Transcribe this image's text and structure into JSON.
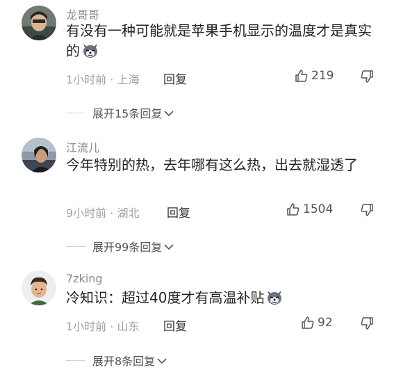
{
  "comments": [
    {
      "username": "龙哥哥",
      "text": "有没有一种可能就是苹果手机显示的温度才是真实的",
      "emoji": "dog-emoji",
      "meta": "1小时前 · 上海",
      "reply_label": "回复",
      "likes": "219",
      "expand_label": "展开15条回复"
    },
    {
      "username": "江流儿",
      "text": "今年特别的热，去年哪有这么热，出去就湿透了",
      "emoji": "",
      "meta": "9小时前 · 湖北",
      "reply_label": "回复",
      "likes": "1504",
      "expand_label": "展开99条回复"
    },
    {
      "username": "7zking",
      "text": "冷知识：超过40度才有高温补贴",
      "emoji": "dog-emoji",
      "meta": "1小时前 · 山东",
      "reply_label": "回复",
      "likes": "92",
      "expand_label": "展开8条回复"
    }
  ],
  "colors": {
    "username": "#8a8a8a",
    "meta": "#a0a0a0",
    "text": "#222222"
  }
}
